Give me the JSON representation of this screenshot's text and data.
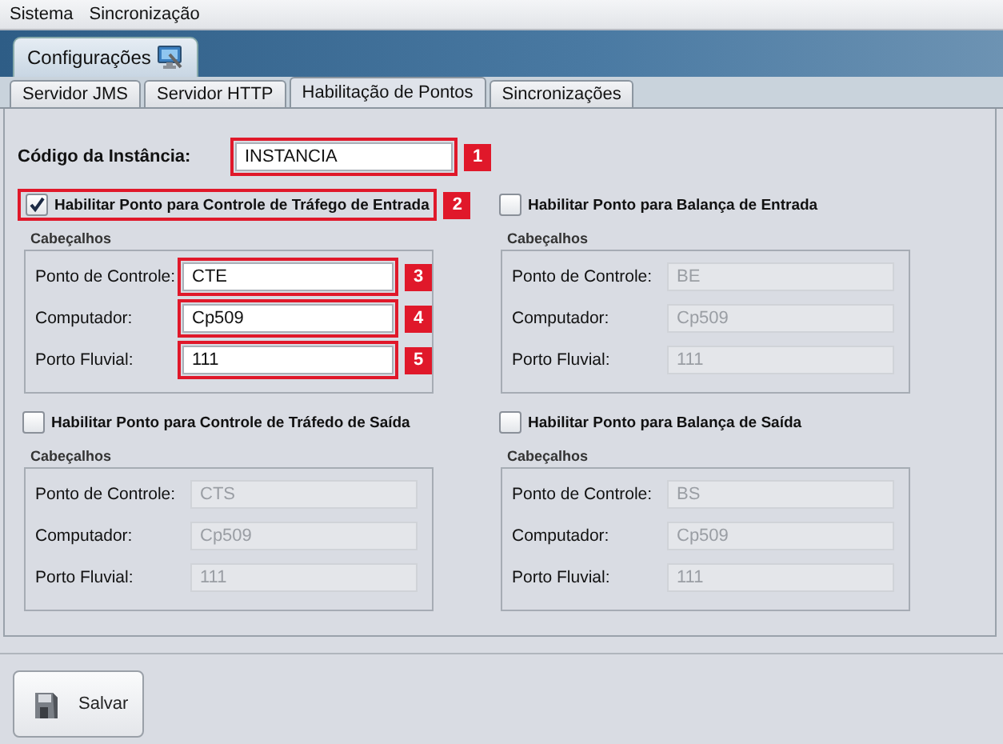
{
  "menu": [
    "Sistema",
    "Sincronização"
  ],
  "main_tabs": [
    {
      "label": "Configurações",
      "selected": true
    }
  ],
  "sub_tabs": [
    {
      "label": "Servidor JMS",
      "selected": false
    },
    {
      "label": "Servidor HTTP",
      "selected": false
    },
    {
      "label": "Habilitação de Pontos",
      "selected": true
    },
    {
      "label": "Sincronizações",
      "selected": false
    }
  ],
  "instance": {
    "label": "Código da Instância:",
    "value": "INSTANCIA",
    "callout": "1"
  },
  "sections": [
    {
      "label": "Habilitar Ponto para Controle de Tráfego de Entrada",
      "checked": true,
      "callout": "2",
      "group_title": "Cabeçalhos",
      "fields": [
        {
          "label": "Ponto de Controle:",
          "value": "CTE",
          "disabled": false,
          "callout": "3"
        },
        {
          "label": "Computador:",
          "value": "Cp509",
          "disabled": false,
          "callout": "4"
        },
        {
          "label": "Porto Fluvial:",
          "value": "111",
          "disabled": false,
          "callout": "5"
        }
      ]
    },
    {
      "label": "Habilitar Ponto para Balança de Entrada",
      "checked": false,
      "group_title": "Cabeçalhos",
      "fields": [
        {
          "label": "Ponto de Controle:",
          "value": "BE",
          "disabled": true
        },
        {
          "label": "Computador:",
          "value": "Cp509",
          "disabled": true
        },
        {
          "label": "Porto Fluvial:",
          "value": "111",
          "disabled": true
        }
      ]
    },
    {
      "label": "Habilitar Ponto para Controle de Tráfedo de Saída",
      "checked": false,
      "group_title": "Cabeçalhos",
      "fields": [
        {
          "label": "Ponto de Controle:",
          "value": "CTS",
          "disabled": true
        },
        {
          "label": "Computador:",
          "value": "Cp509",
          "disabled": true
        },
        {
          "label": "Porto Fluvial:",
          "value": "111",
          "disabled": true
        }
      ]
    },
    {
      "label": "Habilitar Ponto para Balança de Saída",
      "checked": false,
      "group_title": "Cabeçalhos",
      "fields": [
        {
          "label": "Ponto de Controle:",
          "value": "BS",
          "disabled": true
        },
        {
          "label": "Computador:",
          "value": "Cp509",
          "disabled": true
        },
        {
          "label": "Porto Fluvial:",
          "value": "111",
          "disabled": true
        }
      ]
    }
  ],
  "buttons": [
    {
      "label": "Salvar"
    }
  ]
}
